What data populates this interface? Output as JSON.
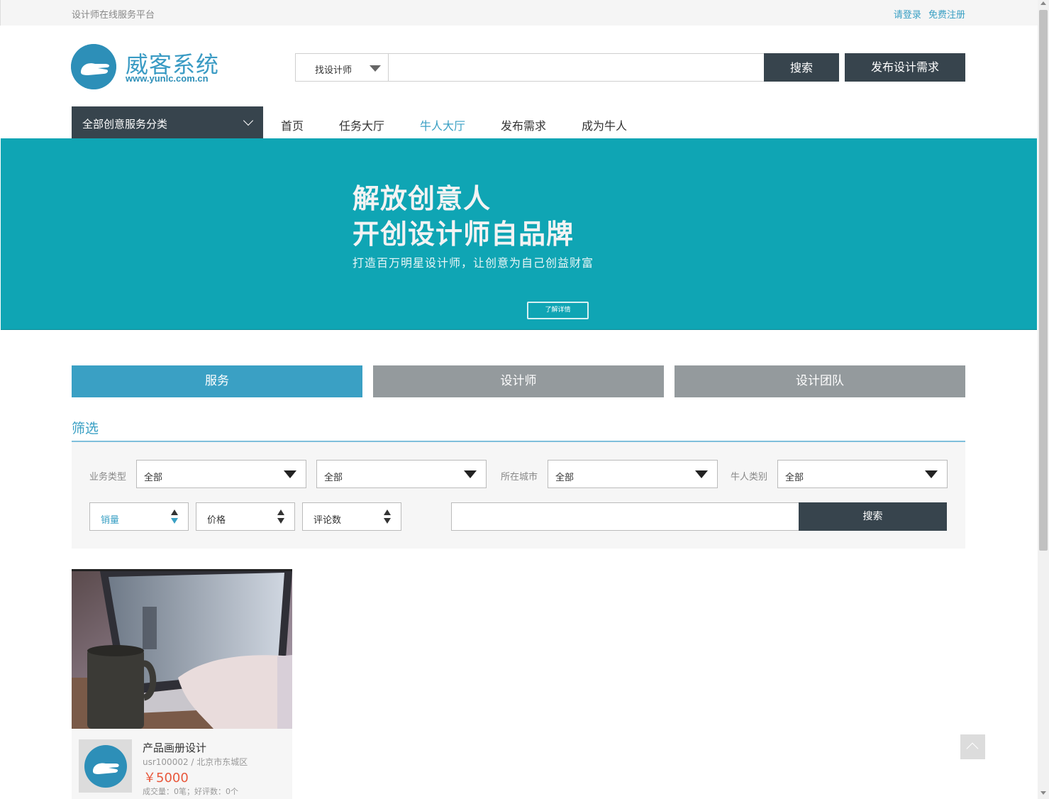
{
  "topbar": {
    "slogan": "设计师在线服务平台",
    "login": "请登录",
    "register": "免费注册"
  },
  "logo": {
    "name": "威客系统",
    "url": "www.yunlc.com.cn",
    "icon": "hand-circle-logo"
  },
  "header_search": {
    "type_label": "找设计师",
    "input_value": "",
    "search_label": "搜索",
    "publish_label": "发布设计需求"
  },
  "nav": {
    "category_label": "全部创意服务分类",
    "items": [
      {
        "label": "首页",
        "active": false
      },
      {
        "label": "任务大厅",
        "active": false
      },
      {
        "label": "牛人大厅",
        "active": true
      },
      {
        "label": "发布需求",
        "active": false
      },
      {
        "label": "成为牛人",
        "active": false
      }
    ]
  },
  "banner": {
    "line1": "解放创意人",
    "line2": "开创设计师自品牌",
    "subtitle": "打造百万明星设计师，让创意为自己创益财富",
    "button": "了解详情",
    "bg_color": "#0fa5b4"
  },
  "tabs": [
    {
      "label": "服务",
      "active": true
    },
    {
      "label": "设计师",
      "active": false
    },
    {
      "label": "设计团队",
      "active": false
    }
  ],
  "filter": {
    "title": "筛选",
    "business_type_label": "业务类型",
    "business_type_value": "全部",
    "business_sub_value": "全部",
    "city_label": "所在城市",
    "city_value": "全部",
    "talent_type_label": "牛人类别",
    "talent_type_value": "全部",
    "sorts": [
      {
        "label": "销量",
        "active": true
      },
      {
        "label": "价格",
        "active": false
      },
      {
        "label": "评论数",
        "active": false
      }
    ],
    "keyword_value": "",
    "search_label": "搜索"
  },
  "cards": [
    {
      "title": "产品画册设计",
      "meta": "usr100002 / 北京市东城区",
      "price": "￥5000",
      "stats": "成交量：0笔；好评数：0个"
    }
  ],
  "colors": {
    "accent": "#3aa0c4",
    "dark": "#37444d",
    "tab_inactive": "#949a9d",
    "price": "#e8583c"
  }
}
